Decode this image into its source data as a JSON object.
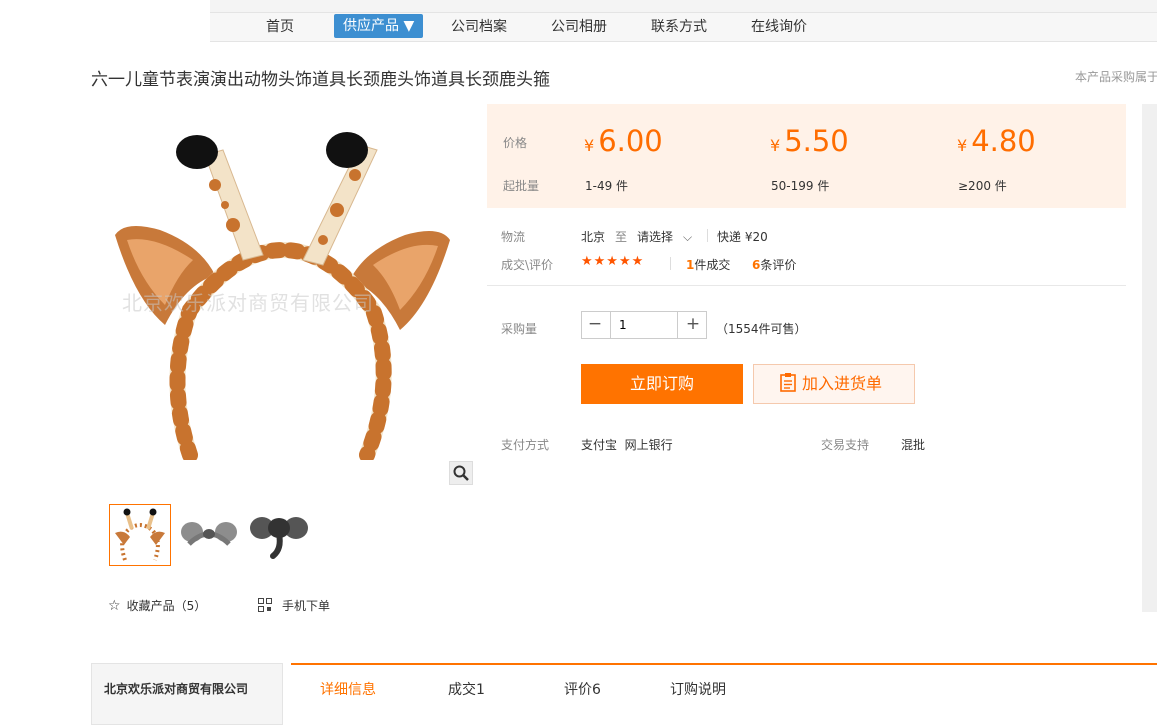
{
  "nav": {
    "items": [
      "首页",
      "供应产品 ▼",
      "公司档案",
      "公司相册",
      "联系方式",
      "在线询价"
    ]
  },
  "product": {
    "title": "六一儿童节表演演出动物头饰道具长颈鹿头饰道具长颈鹿头箍",
    "notice": "本产品采购属于",
    "watermark": "北京欢乐派对商贸有限公司"
  },
  "price": {
    "price_label": "价格",
    "batch_label": "起批量",
    "currency": "¥",
    "tiers": [
      {
        "price": "6.00",
        "qty": "1-49 件"
      },
      {
        "price": "5.50",
        "qty": "50-199 件"
      },
      {
        "price": "4.80",
        "qty": "≥200 件"
      }
    ]
  },
  "logistics": {
    "label": "物流",
    "from": "北京",
    "to_word": "至",
    "dest": "请选择",
    "shipping": "快递 ¥20"
  },
  "deals": {
    "label": "成交\\评价",
    "stars": "★★★★★",
    "deal_count": "1",
    "deal_text": "件成交",
    "review_count": "6",
    "review_text": "条评价"
  },
  "purchase": {
    "label": "采购量",
    "minus": "−",
    "plus": "+",
    "value": "1",
    "stock": "（1554件可售）"
  },
  "buttons": {
    "order": "立即订购",
    "cart": "加入进货单"
  },
  "payment": {
    "label": "支付方式",
    "methods": "支付宝  网上银行",
    "support_label": "交易支持",
    "support": "混批"
  },
  "actions": {
    "favorite": "收藏产品（5）",
    "mobile": "手机下单"
  },
  "bottom": {
    "company": "北京欢乐派对商贸有限公司",
    "tabs": [
      "详细信息",
      "成交1",
      "评价6",
      "订购说明"
    ]
  },
  "colors": {
    "accent": "#ff7300",
    "nav_active": "#3d8fd1",
    "price_bg": "#fff2e8"
  }
}
